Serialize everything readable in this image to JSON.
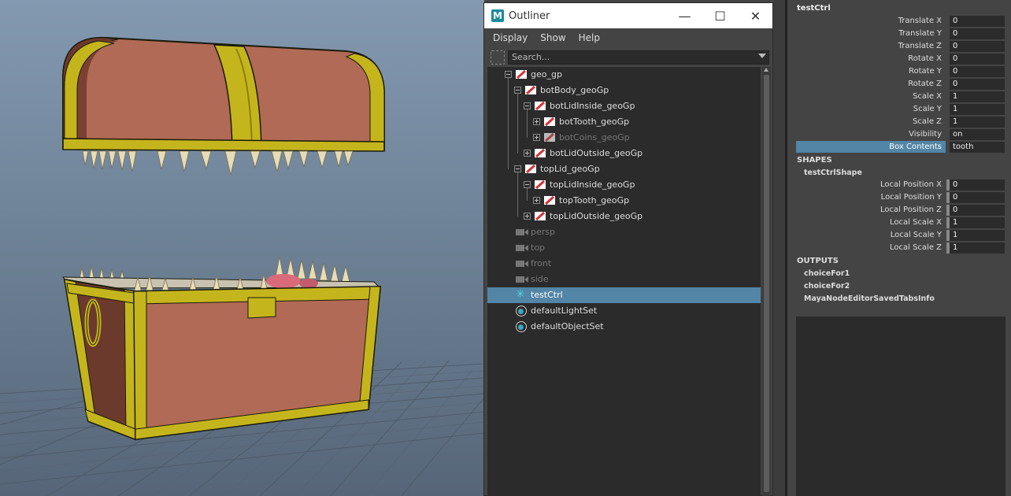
{
  "outliner": {
    "title": "Outliner",
    "logo_letter": "M",
    "menu": [
      "Display",
      "Show",
      "Help"
    ],
    "search_placeholder": "Search...",
    "window_buttons": {
      "minimize": "—",
      "maximize": "☐",
      "close": "✕"
    },
    "items": [
      {
        "label": "geo_gp",
        "type": "group",
        "expander": "minus",
        "dim": false
      },
      {
        "label": "botBody_geoGp",
        "type": "group",
        "expander": "minus",
        "dim": false
      },
      {
        "label": "botLidInside_geoGp",
        "type": "group",
        "expander": "minus",
        "dim": false
      },
      {
        "label": "botTooth_geoGp",
        "type": "group",
        "expander": "plus",
        "dim": false
      },
      {
        "label": "botCoins_geoGp",
        "type": "group",
        "expander": "plus",
        "dim": true
      },
      {
        "label": "botLidOutside_geoGp",
        "type": "group",
        "expander": "plus",
        "dim": false
      },
      {
        "label": "topLid_geoGp",
        "type": "group",
        "expander": "minus",
        "dim": false
      },
      {
        "label": "topLidInside_geoGp",
        "type": "group",
        "expander": "minus",
        "dim": false
      },
      {
        "label": "topTooth_geoGp",
        "type": "group",
        "expander": "plus",
        "dim": false
      },
      {
        "label": "topLidOutside_geoGp",
        "type": "group",
        "expander": "plus",
        "dim": false
      },
      {
        "label": "persp",
        "type": "camera",
        "dim": true
      },
      {
        "label": "top",
        "type": "camera",
        "dim": true
      },
      {
        "label": "front",
        "type": "camera",
        "dim": true
      },
      {
        "label": "side",
        "type": "camera",
        "dim": true
      },
      {
        "label": "testCtrl",
        "type": "control",
        "selected": true
      },
      {
        "label": "defaultLightSet",
        "type": "set"
      },
      {
        "label": "defaultObjectSet",
        "type": "set"
      }
    ]
  },
  "channel_box": {
    "node_name": "testCtrl",
    "attributes": [
      {
        "label": "Translate X",
        "value": "0"
      },
      {
        "label": "Translate Y",
        "value": "0"
      },
      {
        "label": "Translate Z",
        "value": "0"
      },
      {
        "label": "Rotate X",
        "value": "0"
      },
      {
        "label": "Rotate Y",
        "value": "0"
      },
      {
        "label": "Rotate Z",
        "value": "0"
      },
      {
        "label": "Scale X",
        "value": "1"
      },
      {
        "label": "Scale Y",
        "value": "1"
      },
      {
        "label": "Scale Z",
        "value": "1"
      },
      {
        "label": "Visibility",
        "value": "on"
      },
      {
        "label": "Box Contents",
        "value": "tooth",
        "highlighted": true
      }
    ],
    "shapes_header": "SHAPES",
    "shape_name": "testCtrlShape",
    "shape_attributes": [
      {
        "label": "Local Position X",
        "value": "0"
      },
      {
        "label": "Local Position Y",
        "value": "0"
      },
      {
        "label": "Local Position Z",
        "value": "0"
      },
      {
        "label": "Local Scale X",
        "value": "1"
      },
      {
        "label": "Local Scale Y",
        "value": "1"
      },
      {
        "label": "Local Scale Z",
        "value": "1"
      }
    ],
    "outputs_header": "OUTPUTS",
    "outputs": [
      "choiceFor1",
      "choiceFor2",
      "MayaNodeEditorSavedTabsInfo"
    ]
  },
  "colors": {
    "selection": "#5285a6",
    "panel_bg": "#444444",
    "field_bg": "#2b2b2b",
    "chest_wood": "#b06a55",
    "chest_trim": "#b8a818"
  },
  "icons": {
    "group": "group-transform-icon",
    "camera": "camera-icon",
    "set": "object-set-icon",
    "control": "control-curve-icon"
  }
}
